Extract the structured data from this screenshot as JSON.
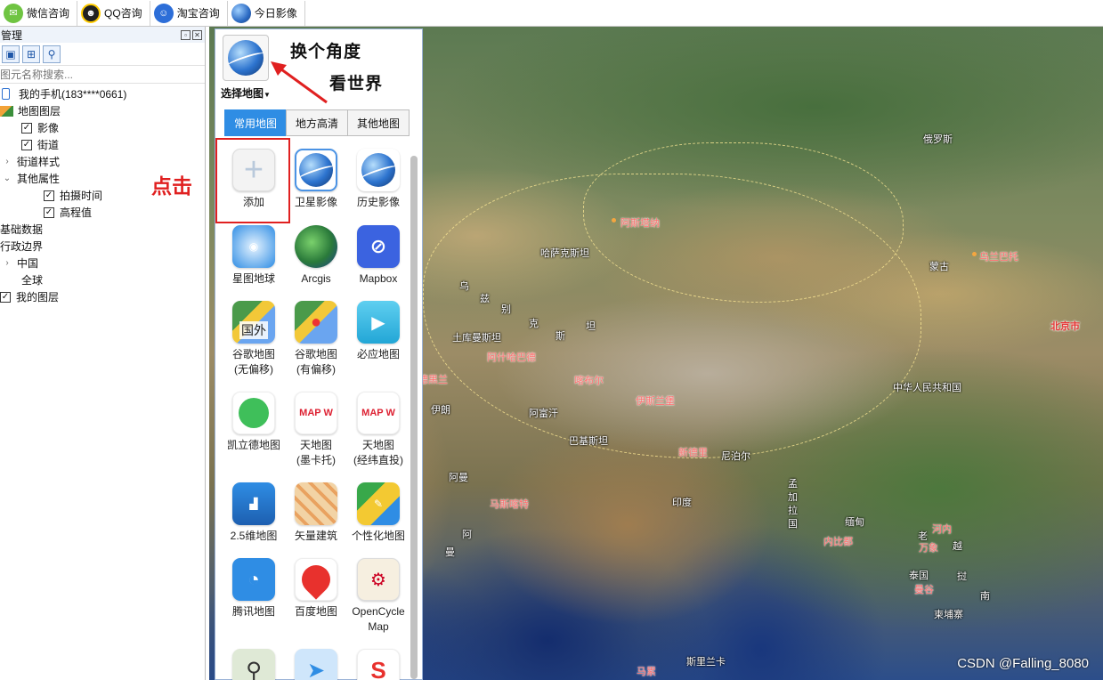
{
  "toolbar": {
    "items": [
      {
        "label": "微信咨询",
        "icon": "wechat-icon"
      },
      {
        "label": "QQ咨询",
        "icon": "qq-icon"
      },
      {
        "label": "淘宝咨询",
        "icon": "taobao-icon"
      },
      {
        "label": "今日影像",
        "icon": "earth-icon"
      }
    ]
  },
  "left_panel": {
    "title": "管理",
    "search_placeholder": "图元名称搜索...",
    "tree": [
      {
        "label": "我的手机(183****0661)",
        "icon": "phone-icon"
      },
      {
        "label": "地图图层",
        "icon": "layers-icon"
      },
      {
        "label": "影像",
        "checked": true
      },
      {
        "label": "街道",
        "checked": true
      },
      {
        "label": "街道样式",
        "expander": "›"
      },
      {
        "label": "其他属性",
        "expander": "⌄"
      },
      {
        "label": "拍摄时间",
        "checked": true
      },
      {
        "label": "高程值",
        "checked": true
      },
      {
        "label": "基础数据"
      },
      {
        "label": "行政边界"
      },
      {
        "label": "中国",
        "expander": "›"
      },
      {
        "label": "全球"
      },
      {
        "label": "我的图层",
        "checked": true
      }
    ]
  },
  "popup": {
    "select_label": "选择地图",
    "annotation_line1": "换个角度",
    "annotation_line2": "看世界",
    "tabs": [
      "常用地图",
      "地方高清",
      "其他地图"
    ],
    "active_tab": "常用地图",
    "click_note": "点击",
    "apps": [
      {
        "name": "添加",
        "icon": "add-icon"
      },
      {
        "name": "卫星影像",
        "icon": "satellite-globe-icon"
      },
      {
        "name": "历史影像",
        "icon": "history-globe-icon"
      },
      {
        "name": "星图地球",
        "icon": "startmap-icon"
      },
      {
        "name": "Arcgis",
        "icon": "arcgis-icon"
      },
      {
        "name": "Mapbox",
        "icon": "mapbox-icon"
      },
      {
        "name": "谷歌地图\n(无偏移)",
        "icon": "google-maps-icon",
        "badge": "国外"
      },
      {
        "name": "谷歌地图\n(有偏移)",
        "icon": "google-maps-icon"
      },
      {
        "name": "必应地图",
        "icon": "bing-maps-icon"
      },
      {
        "name": "凯立德地图",
        "icon": "careland-icon"
      },
      {
        "name": "天地图\n(墨卡托)",
        "icon": "tianditu-icon"
      },
      {
        "name": "天地图\n(经纬直投)",
        "icon": "tianditu-icon"
      },
      {
        "name": "2.5维地图",
        "icon": "map-25d-icon"
      },
      {
        "name": "矢量建筑",
        "icon": "vector-building-icon"
      },
      {
        "name": "个性化地图",
        "icon": "custom-map-icon"
      },
      {
        "name": "腾讯地图",
        "icon": "tencent-map-icon"
      },
      {
        "name": "百度地图",
        "icon": "baidu-map-icon"
      },
      {
        "name": "OpenCycle\nMap",
        "icon": "opencycle-icon"
      },
      {
        "name": "",
        "icon": "magnifier-map-icon"
      },
      {
        "name": "",
        "icon": "navigation-icon"
      },
      {
        "name": "",
        "icon": "sogou-map-icon"
      }
    ]
  },
  "map": {
    "labels": [
      {
        "text": "俄罗斯",
        "type": "white"
      },
      {
        "text": "阿斯塔纳",
        "type": "red"
      },
      {
        "text": "乌兰巴托",
        "type": "red"
      },
      {
        "text": "哈萨克斯坦",
        "type": "white"
      },
      {
        "text": "蒙古",
        "type": "white"
      },
      {
        "text": "乌",
        "type": "white"
      },
      {
        "text": "兹",
        "type": "white"
      },
      {
        "text": "别",
        "type": "white"
      },
      {
        "text": "克",
        "type": "white"
      },
      {
        "text": "斯",
        "type": "white"
      },
      {
        "text": "坦",
        "type": "white"
      },
      {
        "text": "北京市",
        "type": "cap"
      },
      {
        "text": "土库曼斯坦",
        "type": "white"
      },
      {
        "text": "阿什哈巴德",
        "type": "red"
      },
      {
        "text": "喀布尔",
        "type": "red"
      },
      {
        "text": "德黑兰",
        "type": "red"
      },
      {
        "text": "伊斯兰堡",
        "type": "red"
      },
      {
        "text": "中华人民共和国",
        "type": "white"
      },
      {
        "text": "伊朗",
        "type": "white"
      },
      {
        "text": "阿富汗",
        "type": "white"
      },
      {
        "text": "巴基斯坦",
        "type": "white"
      },
      {
        "text": "新德里",
        "type": "red"
      },
      {
        "text": "尼泊尔",
        "type": "white"
      },
      {
        "text": "阿曼",
        "type": "white"
      },
      {
        "text": "马斯喀特",
        "type": "red"
      },
      {
        "text": "印度",
        "type": "white"
      },
      {
        "text": "孟",
        "type": "white"
      },
      {
        "text": "加",
        "type": "white"
      },
      {
        "text": "拉",
        "type": "white"
      },
      {
        "text": "国",
        "type": "white"
      },
      {
        "text": "缅甸",
        "type": "white"
      },
      {
        "text": "河内",
        "type": "red"
      },
      {
        "text": "老",
        "type": "white"
      },
      {
        "text": "万象",
        "type": "red"
      },
      {
        "text": "越",
        "type": "white"
      },
      {
        "text": "阿",
        "type": "white"
      },
      {
        "text": "曼",
        "type": "white"
      },
      {
        "text": "内比都",
        "type": "red"
      },
      {
        "text": "泰国",
        "type": "white"
      },
      {
        "text": "曼谷",
        "type": "red"
      },
      {
        "text": "挝",
        "type": "white"
      },
      {
        "text": "南",
        "type": "white"
      },
      {
        "text": "柬埔寨",
        "type": "white"
      },
      {
        "text": "斯里兰卡",
        "type": "white"
      },
      {
        "text": "马累",
        "type": "red"
      }
    ],
    "watermark": "CSDN @Falling_8080"
  },
  "colors": {
    "accent": "#2f8de4",
    "highlight": "#e02020"
  }
}
